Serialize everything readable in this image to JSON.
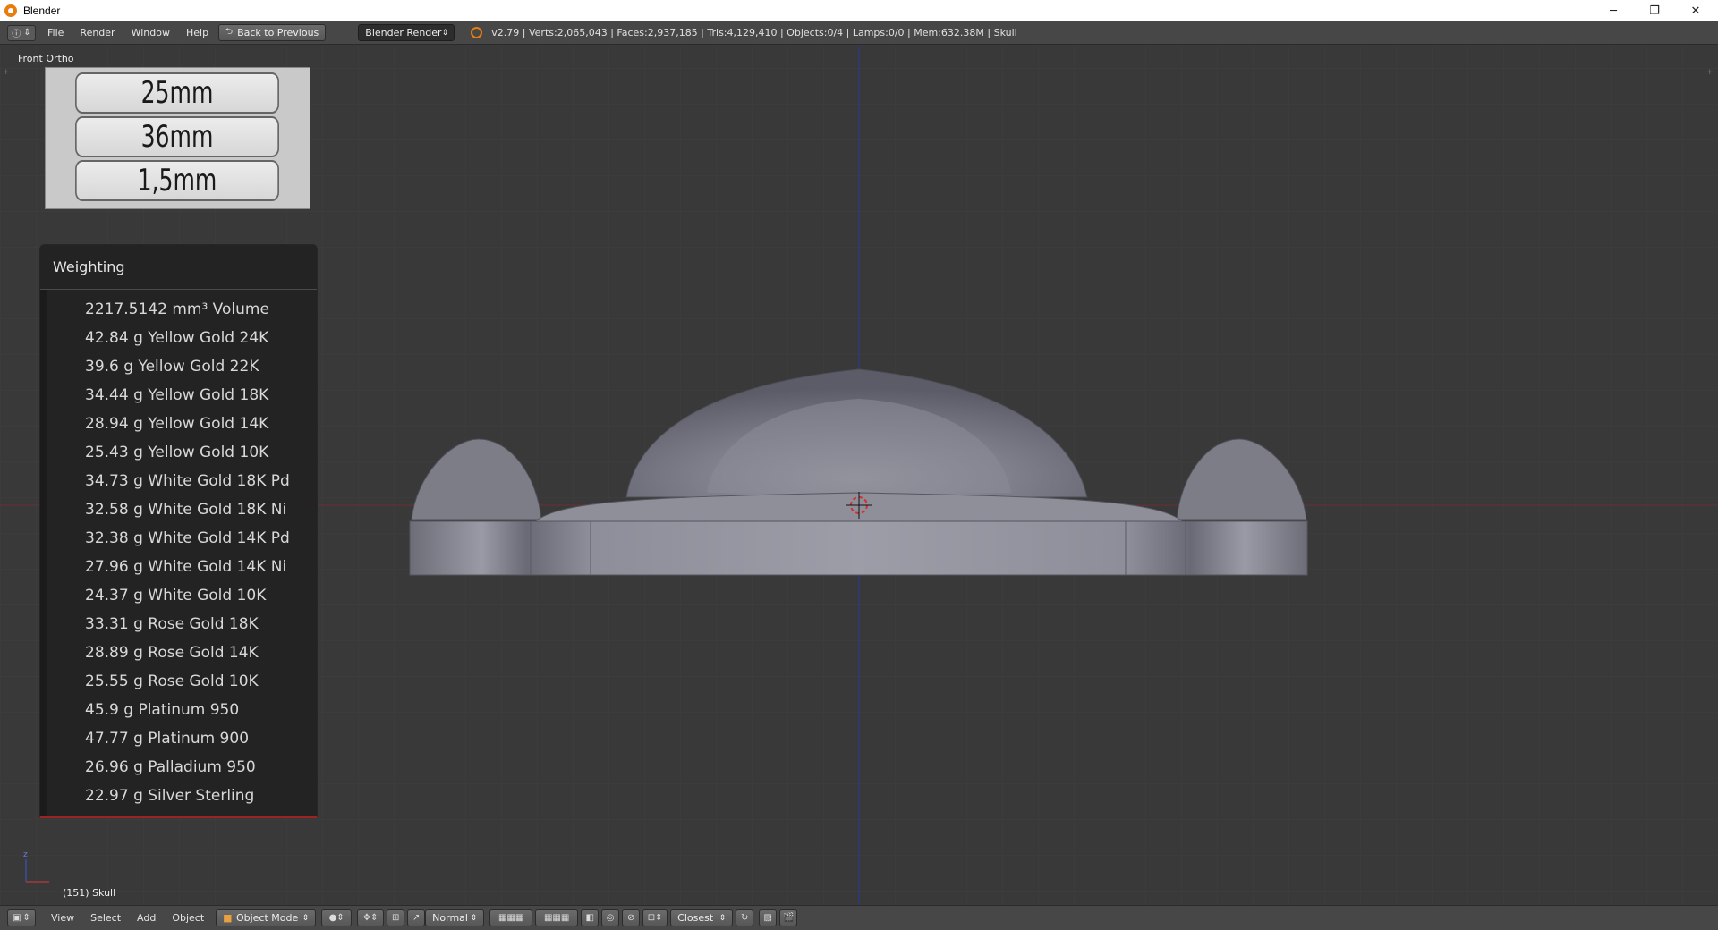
{
  "window": {
    "title": "Blender",
    "minimize_glyph": "─",
    "maximize_glyph": "❐",
    "close_glyph": "✕"
  },
  "infobar": {
    "editor_icon": "info-icon",
    "menus": [
      "File",
      "Render",
      "Window",
      "Help"
    ],
    "back_button": "Back to Previous",
    "render_engine": "Blender Render",
    "stats": "v2.79 | Verts:2,065,043 | Faces:2,937,185 | Tris:4,129,410 | Objects:0/4 | Lamps:0/0 | Mem:632.38M | Skull"
  },
  "viewport": {
    "view_name": "Front Ortho",
    "object_label": "(151) Skull",
    "dimensions": [
      "25mm",
      "36mm",
      "1,5mm"
    ]
  },
  "weighting": {
    "title": "Weighting",
    "rows": [
      "2217.5142 mm³  Volume",
      "42.84 g  Yellow Gold 24K",
      "39.6 g  Yellow Gold 22K",
      "34.44 g  Yellow Gold 18K",
      "28.94 g  Yellow Gold 14K",
      "25.43 g  Yellow Gold 10K",
      "34.73 g  White Gold 18K Pd",
      "32.58 g  White Gold 18K Ni",
      "32.38 g  White Gold 14K Pd",
      "27.96 g  White Gold 14K Ni",
      "24.37 g  White Gold 10K",
      "33.31 g  Rose Gold 18K",
      "28.89 g  Rose Gold 14K",
      "25.55 g  Rose Gold 10K",
      "45.9 g  Platinum 950",
      "47.77 g  Platinum 900",
      "26.96 g  Palladium 950",
      "22.97 g  Silver Sterling"
    ]
  },
  "footer": {
    "menus": [
      "View",
      "Select",
      "Add",
      "Object"
    ],
    "mode": "Object Mode",
    "pivot": "Normal",
    "snap": "Closest"
  },
  "colors": {
    "viewport_bg": "#393939",
    "header_bg": "#474747",
    "x_axis": "#8a2a2a",
    "z_axis": "#2b3c8c",
    "panel_bottom_accent": "#9c2323"
  }
}
